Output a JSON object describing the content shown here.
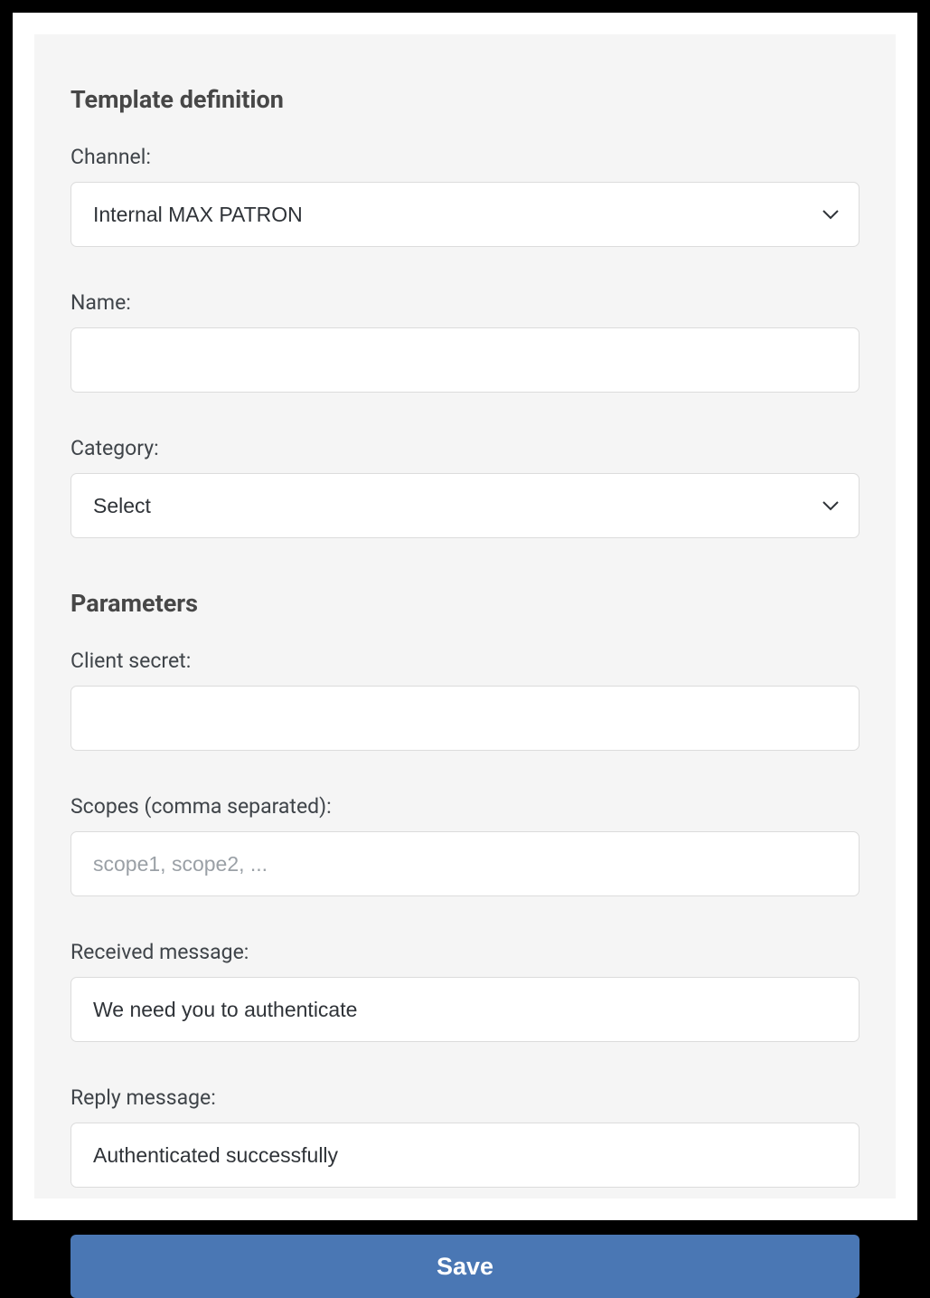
{
  "sections": {
    "definition_title": "Template definition",
    "parameters_title": "Parameters"
  },
  "fields": {
    "channel": {
      "label": "Channel:",
      "selected": "Internal MAX PATRON"
    },
    "name": {
      "label": "Name:",
      "value": ""
    },
    "category": {
      "label": "Category:",
      "selected": "Select"
    },
    "client_secret": {
      "label": "Client secret:",
      "value": ""
    },
    "scopes": {
      "label": "Scopes (comma separated):",
      "placeholder": "scope1, scope2, ...",
      "value": ""
    },
    "received_message": {
      "label": "Received message:",
      "value": "We need you to authenticate"
    },
    "reply_message": {
      "label": "Reply message:",
      "value": "Authenticated successfully"
    }
  },
  "actions": {
    "save_label": "Save"
  }
}
